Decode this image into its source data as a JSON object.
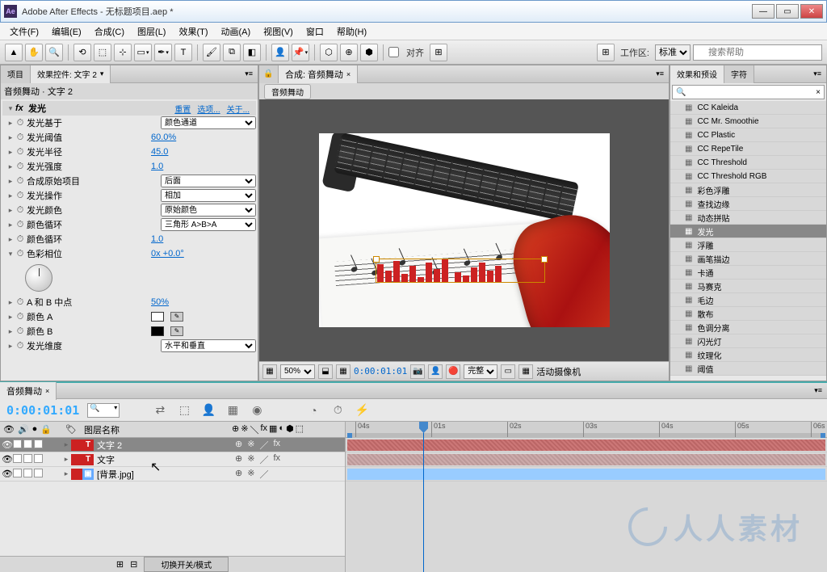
{
  "window": {
    "title": "Adobe After Effects - 无标题项目.aep *"
  },
  "menu": [
    "文件(F)",
    "编辑(E)",
    "合成(C)",
    "图层(L)",
    "效果(T)",
    "动画(A)",
    "视图(V)",
    "窗口",
    "帮助(H)"
  ],
  "toolbar": {
    "snap_label": "对齐",
    "workspace_label": "工作区:",
    "workspace_value": "标准",
    "search_placeholder": "搜索帮助"
  },
  "leftPanel": {
    "tabs": [
      {
        "label": "项目",
        "active": false
      },
      {
        "label": "效果控件: 文字 2",
        "active": true
      }
    ],
    "header": "音频舞动 · 文字 2",
    "effect_name": "发光",
    "links": [
      "重置",
      "选项...",
      "关于..."
    ],
    "params": [
      {
        "kind": "sel",
        "name": "发光基于",
        "value": "颜色通道"
      },
      {
        "kind": "num",
        "name": "发光阈值",
        "value": "60.0%"
      },
      {
        "kind": "num",
        "name": "发光半径",
        "value": "45.0"
      },
      {
        "kind": "num",
        "name": "发光强度",
        "value": "1.0"
      },
      {
        "kind": "sel",
        "name": "合成原始项目",
        "value": "后面"
      },
      {
        "kind": "sel",
        "name": "发光操作",
        "value": "相加"
      },
      {
        "kind": "sel",
        "name": "发光颜色",
        "value": "原始颜色"
      },
      {
        "kind": "sel",
        "name": "颜色循环",
        "value": "三角形 A>B>A"
      },
      {
        "kind": "num",
        "name": "颜色循环",
        "value": "1.0"
      },
      {
        "kind": "dial",
        "name": "色彩相位",
        "value": "0x +0.0°"
      },
      {
        "kind": "num",
        "name": "A 和 B 中点",
        "value": "50%"
      },
      {
        "kind": "color",
        "name": "颜色 A",
        "value": "#ffffff"
      },
      {
        "kind": "color",
        "name": "颜色 B",
        "value": "#000000"
      },
      {
        "kind": "sel",
        "name": "发光维度",
        "value": "水平和垂直"
      }
    ]
  },
  "comp": {
    "tab_prefix": "合成:",
    "name": "音频舞动",
    "footer": {
      "zoom": "50%",
      "timecode": "0:00:01:01",
      "res": "完整",
      "camera": "活动摄像机"
    }
  },
  "rightPanel": {
    "tabs": [
      {
        "label": "效果和预设",
        "active": true
      },
      {
        "label": "字符",
        "active": false
      }
    ],
    "items": [
      "CC Kaleida",
      "CC Mr. Smoothie",
      "CC Plastic",
      "CC RepeTile",
      "CC Threshold",
      "CC Threshold RGB",
      "彩色浮雕",
      "查找边缘",
      "动态拼贴",
      "发光",
      "浮雕",
      "画笔描边",
      "卡通",
      "马赛克",
      "毛边",
      "散布",
      "色调分离",
      "闪光灯",
      "纹理化",
      "阈值"
    ],
    "selected": 9
  },
  "timeline": {
    "tab": "音频舞动",
    "timecode": "0:00:01:01",
    "col_label": "图层名称",
    "toggle": "切换开关/模式",
    "ticks": [
      "04s",
      "01s",
      "02s",
      "03s",
      "04s",
      "05s",
      "06s"
    ],
    "layers": [
      {
        "type": "T",
        "name": "文字 2",
        "selected": true,
        "fx": true
      },
      {
        "type": "T",
        "name": "文字",
        "selected": false,
        "fx": true
      },
      {
        "type": "img",
        "name": "[背景.jpg]",
        "selected": false,
        "fx": false
      }
    ]
  },
  "watermark": "人人素材"
}
